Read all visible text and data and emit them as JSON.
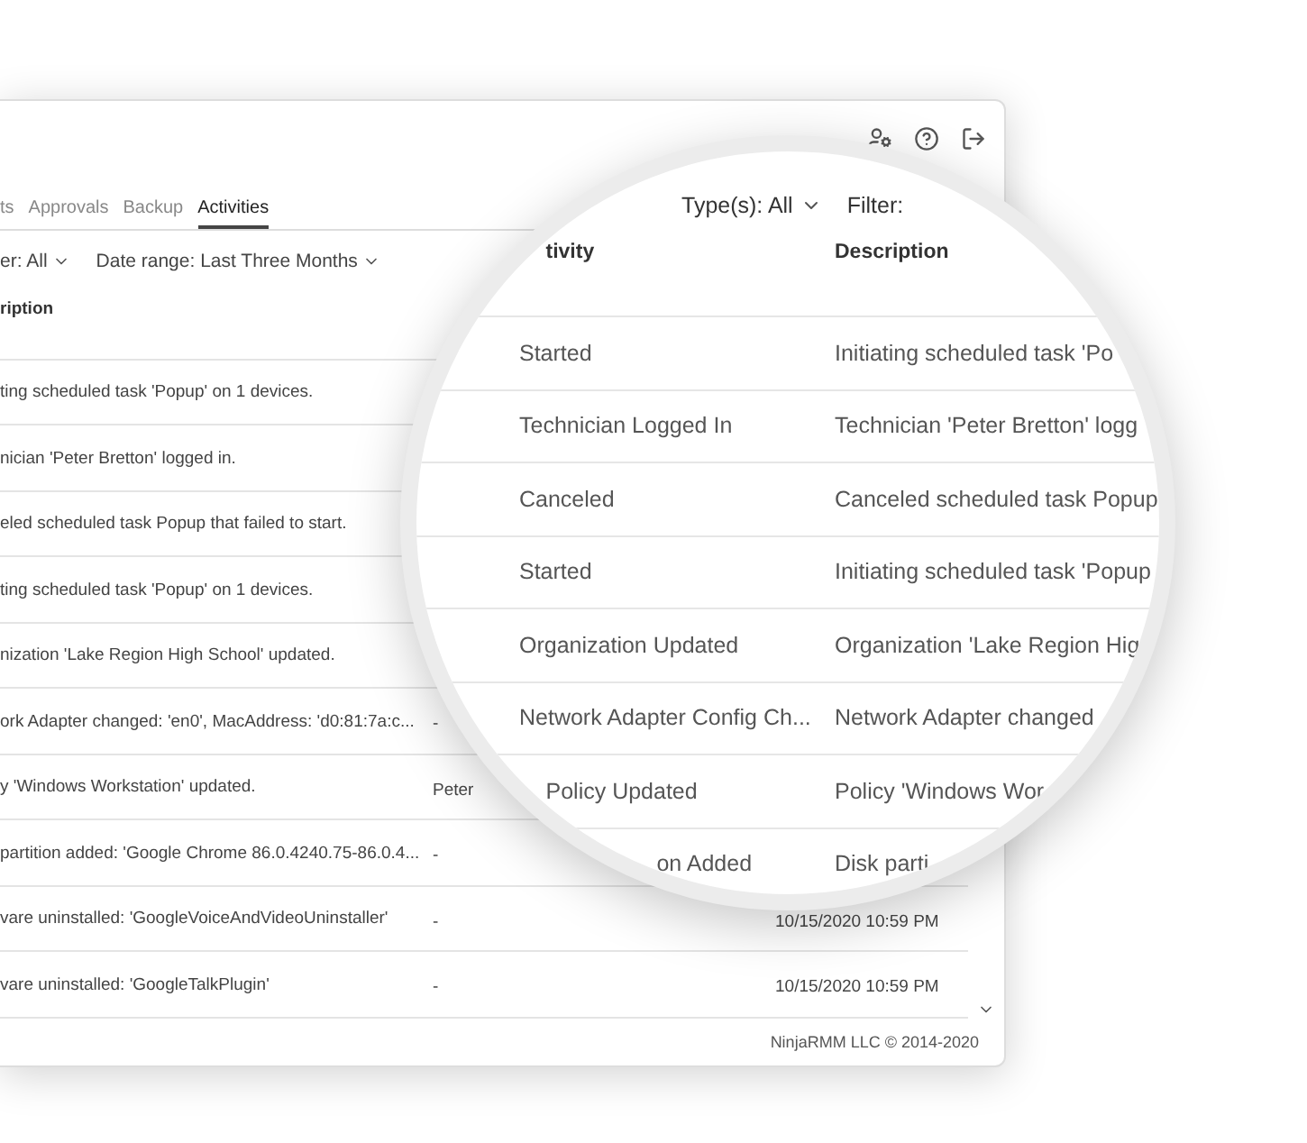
{
  "tabs": [
    {
      "label": "ts",
      "selected": false
    },
    {
      "label": "Approvals",
      "selected": false
    },
    {
      "label": "Backup",
      "selected": false
    },
    {
      "label": "Activities",
      "selected": true
    }
  ],
  "filters": [
    {
      "label": "er:",
      "value": "All"
    },
    {
      "label": "Date range:",
      "value": "Last Three Months"
    }
  ],
  "table": {
    "columns": [
      "ription"
    ],
    "rows": [
      {
        "description": "ting scheduled task 'Popup' on 1 devices."
      },
      {
        "description": "nician 'Peter Bretton' logged in."
      },
      {
        "description": "eled scheduled task Popup that failed to start."
      },
      {
        "description": "ting scheduled task 'Popup' on 1 devices."
      },
      {
        "description": "nization 'Lake Region High School' updated."
      },
      {
        "description": "ork Adapter changed: 'en0', MacAddress: 'd0:81:7a:c...",
        "user": "-"
      },
      {
        "description": "y 'Windows Workstation' updated.",
        "user": "Peter"
      },
      {
        "description": "partition added: 'Google Chrome 86.0.4240.75-86.0.4...",
        "user": "-"
      },
      {
        "description": "vare uninstalled: 'GoogleVoiceAndVideoUninstaller'",
        "user": "-",
        "date": "10/15/2020 10:59 PM"
      },
      {
        "description": "vare uninstalled: 'GoogleTalkPlugin'",
        "user": "-",
        "date": "10/15/2020 10:59 PM"
      }
    ]
  },
  "footer": "NinjaRMM LLC © 2014-2020",
  "magnifier": {
    "filters": [
      {
        "label": "Type(s):",
        "value": "All"
      },
      {
        "label": "Filter:"
      }
    ],
    "columns": [
      "tivity",
      "Description"
    ],
    "rows": [
      {
        "activity": "Started",
        "description": "Initiating scheduled task 'Po"
      },
      {
        "activity": "Technician Logged In",
        "description": "Technician 'Peter Bretton' logg"
      },
      {
        "activity": "Canceled",
        "description": "Canceled scheduled task Popup"
      },
      {
        "activity": "Started",
        "description": "Initiating scheduled task 'Popup"
      },
      {
        "activity": "Organization Updated",
        "description": "Organization 'Lake Region Hig"
      },
      {
        "activity": "Network Adapter Config Ch...",
        "description": "Network Adapter changed"
      },
      {
        "activity": "Policy Updated",
        "description": "Policy 'Windows Wor"
      },
      {
        "activity": "on Added",
        "description": "Disk parti"
      }
    ]
  }
}
